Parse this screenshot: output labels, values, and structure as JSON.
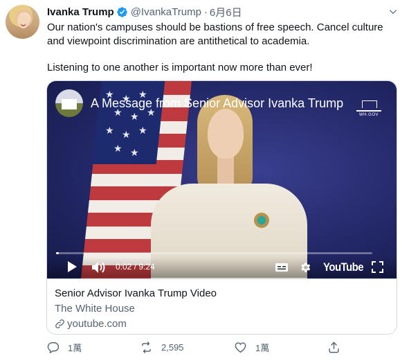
{
  "user": {
    "name": "Ivanka Trump",
    "handle": "@IvankaTrump",
    "separator": "·",
    "date": "6月6日"
  },
  "tweet": {
    "paragraph1": "Our nation's campuses should be bastions of free speech. Cancel culture and viewpoint discrimination are antithetical to academia.",
    "paragraph2": "Listening to one another is important now more than ever!"
  },
  "video": {
    "title": "A Message from Senior Advisor Ivanka Trump",
    "channel_badge": "WH.GOV",
    "current_time": "0:02",
    "duration": "9:24",
    "time_display": "0:02 / 9:24",
    "progress_fraction": 0.004,
    "brand": "YouTube"
  },
  "card": {
    "title": "Senior Advisor Ivanka Trump Video",
    "source": "The White House",
    "link": "youtube.com"
  },
  "actions": {
    "reply_count": "1萬",
    "retweet_count": "2,595",
    "like_count": "1萬"
  },
  "colors": {
    "text_primary": "#0f1419",
    "text_secondary": "#536471",
    "verified_blue": "#1d9bf0",
    "border": "#cfd9de"
  },
  "icons": [
    "verified-icon",
    "caret-down-icon",
    "play-icon",
    "volume-icon",
    "captions-icon",
    "settings-gear-icon",
    "fullscreen-icon",
    "link-icon",
    "reply-icon",
    "retweet-icon",
    "like-icon",
    "share-icon"
  ]
}
